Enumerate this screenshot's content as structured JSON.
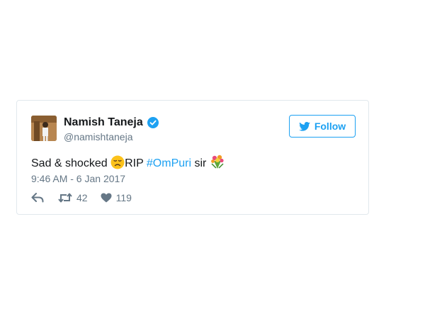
{
  "tweet": {
    "display_name": "Namish Taneja",
    "handle": "@namishtaneja",
    "follow_label": "Follow",
    "text_before": "Sad & shocked ",
    "text_middle": "RIP ",
    "hashtag": "#OmPuri",
    "text_after": " sir ",
    "timestamp": "9:46 AM - 6 Jan 2017",
    "retweet_count": "42",
    "like_count": "119",
    "icons": {
      "verified": "verified-badge-icon",
      "follow": "bird-icon",
      "reply": "reply-icon",
      "retweet": "retweet-icon",
      "like": "heart-icon",
      "emoji_1": "disappointed-face-emoji",
      "emoji_2": "bouquet-emoji"
    },
    "colors": {
      "brand": "#1da1f2",
      "text": "#14171a",
      "muted": "#657786",
      "border": "#e1e8ed"
    }
  }
}
